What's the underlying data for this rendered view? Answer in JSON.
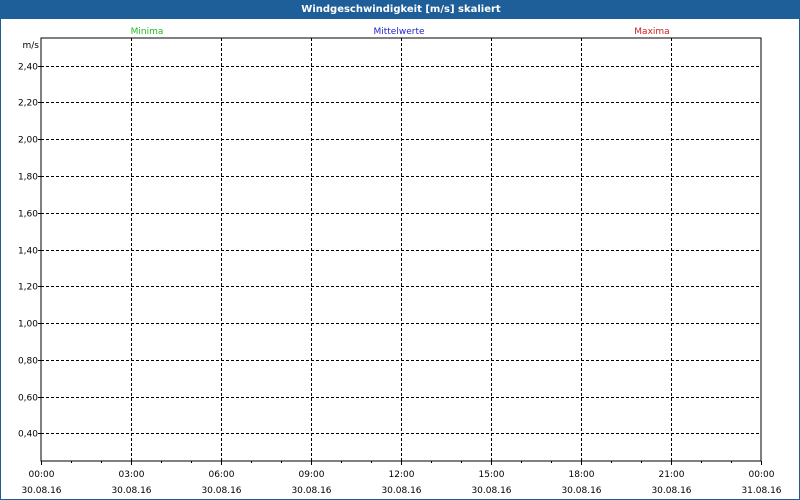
{
  "window": {
    "title": "Windgeschwindigkeit [m/s] skaliert"
  },
  "colors": {
    "titlebar": "#1f5f99",
    "minima": "#22bb22",
    "mittelwerte": "#2222cc",
    "maxima": "#cc2222",
    "grid": "#000000"
  },
  "chart_data": {
    "type": "line",
    "title": "Windgeschwindigkeit [m/s] skaliert",
    "ylabel": "m/s",
    "xlabel": "",
    "ylim": [
      0.25,
      2.55
    ],
    "y_ticks": [
      "2,40",
      "2,20",
      "2,00",
      "1,80",
      "1,60",
      "1,40",
      "1,20",
      "1,00",
      "0,80",
      "0,60",
      "0,40"
    ],
    "y_tick_values": [
      2.4,
      2.2,
      2.0,
      1.8,
      1.6,
      1.4,
      1.2,
      1.0,
      0.8,
      0.6,
      0.4
    ],
    "x_ticks": [
      {
        "time": "00:00",
        "date": "30.08.16"
      },
      {
        "time": "03:00",
        "date": "30.08.16"
      },
      {
        "time": "06:00",
        "date": "30.08.16"
      },
      {
        "time": "09:00",
        "date": "30.08.16"
      },
      {
        "time": "12:00",
        "date": "30.08.16"
      },
      {
        "time": "15:00",
        "date": "30.08.16"
      },
      {
        "time": "18:00",
        "date": "30.08.16"
      },
      {
        "time": "21:00",
        "date": "30.08.16"
      },
      {
        "time": "00:00",
        "date": "31.08.16"
      }
    ],
    "grid": true,
    "series": [
      {
        "name": "Minima",
        "color": "#22bb22",
        "values": []
      },
      {
        "name": "Mittelwerte",
        "color": "#2222cc",
        "values": []
      },
      {
        "name": "Maxima",
        "color": "#cc2222",
        "values": []
      }
    ]
  }
}
